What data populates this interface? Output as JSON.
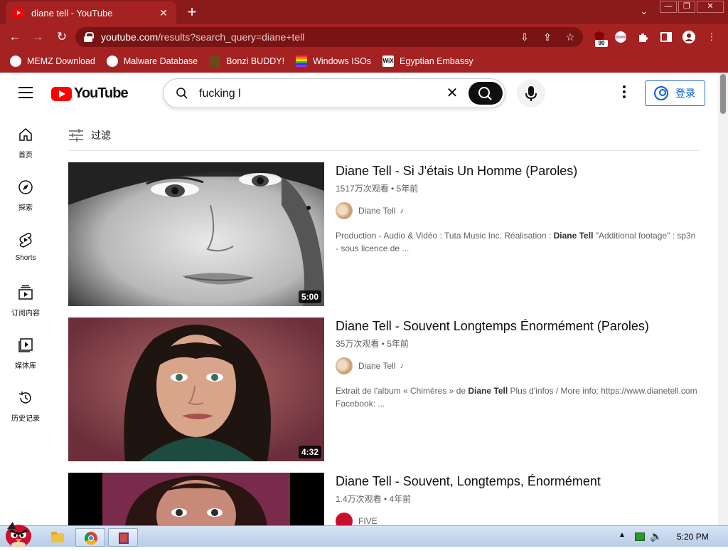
{
  "browser": {
    "tab_title": "diane tell - YouTube",
    "url_host": "youtube.com",
    "url_path": "/results?search_query=diane+tell",
    "extension_badge": "90",
    "bookmarks": [
      {
        "label": "MEMZ Download",
        "icon": "globe-icon"
      },
      {
        "label": "Malware Database",
        "icon": "globe-icon"
      },
      {
        "label": "Bonzi BUDDY!",
        "icon": "bonzi-icon"
      },
      {
        "label": "Windows ISOs",
        "icon": "rainbow-icon"
      },
      {
        "label": "Egyptian Embassy",
        "icon": "wix-icon"
      }
    ],
    "wix_text": "WiX"
  },
  "youtube": {
    "logo_text": "YouTube",
    "search_value": "fucking l",
    "signin_label": "登录",
    "filter_label": "过滤",
    "sidebar": [
      {
        "label": "首页",
        "icon": "home-icon"
      },
      {
        "label": "探索",
        "icon": "explore-icon"
      },
      {
        "label": "Shorts",
        "icon": "shorts-icon"
      },
      {
        "label": "订阅内容",
        "icon": "subscriptions-icon"
      },
      {
        "label": "媒体库",
        "icon": "library-icon"
      },
      {
        "label": "历史记录",
        "icon": "history-icon"
      }
    ],
    "results": [
      {
        "title": "Diane Tell - Si J'étais Un Homme (Paroles)",
        "meta": "1517万次观看 • 5年前",
        "channel": "Diane Tell",
        "duration": "5:00",
        "desc_pre": "Production - Audio & Vidéo : Tuta Music Inc. Réalisation : ",
        "desc_bold": "Diane Tell",
        "desc_post": " \"Additional footage\" : sp3n - sous licence de ..."
      },
      {
        "title": "Diane Tell - Souvent Longtemps Énormément (Paroles)",
        "meta": "35万次观看 • 5年前",
        "channel": "Diane Tell",
        "duration": "4:32",
        "desc_pre": "Extrait de l'album « Chimères » de ",
        "desc_bold": "Diane Tell",
        "desc_post": " Plus d'infos / More info: https://www.dianetell.com Facebook: ..."
      },
      {
        "title": "Diane Tell - Souvent, Longtemps, Énormément",
        "meta": "1.4万次观看 • 4年前",
        "channel": "FIVE"
      }
    ]
  },
  "taskbar": {
    "time": "5:20 PM"
  },
  "colors": {
    "browser_frame": "#8b1a1a",
    "youtube_red": "#ff0000",
    "link_blue": "#065fd4"
  }
}
